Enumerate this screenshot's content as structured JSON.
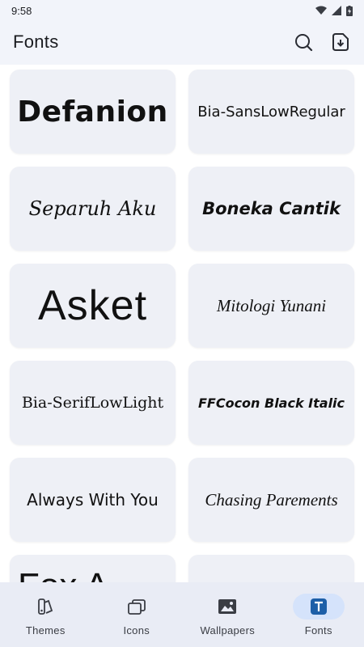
{
  "status_bar": {
    "time": "9:58"
  },
  "app_bar": {
    "title": "Fonts"
  },
  "fonts": [
    {
      "name": "Defanion"
    },
    {
      "name": "Bia-SansLowRegular"
    },
    {
      "name": "Separuh Aku"
    },
    {
      "name": "Boneka Cantik"
    },
    {
      "name": "Asket"
    },
    {
      "name": "Mitologi Yunani"
    },
    {
      "name": "Bia-SerifLowLight"
    },
    {
      "name": "FFCocon Black Italic"
    },
    {
      "name": "Always With You"
    },
    {
      "name": "Chasing Parements"
    },
    {
      "name": "Fox A"
    }
  ],
  "nav": [
    {
      "label": "Themes",
      "icon": "themes-icon"
    },
    {
      "label": "Icons",
      "icon": "icons-icon"
    },
    {
      "label": "Wallpapers",
      "icon": "wallpapers-icon"
    },
    {
      "label": "Fonts",
      "icon": "fonts-icon"
    }
  ],
  "colors": {
    "accent": "#1d5fa8",
    "nav_active_bg": "#d5e3fb",
    "background": "#f2f4fa"
  }
}
